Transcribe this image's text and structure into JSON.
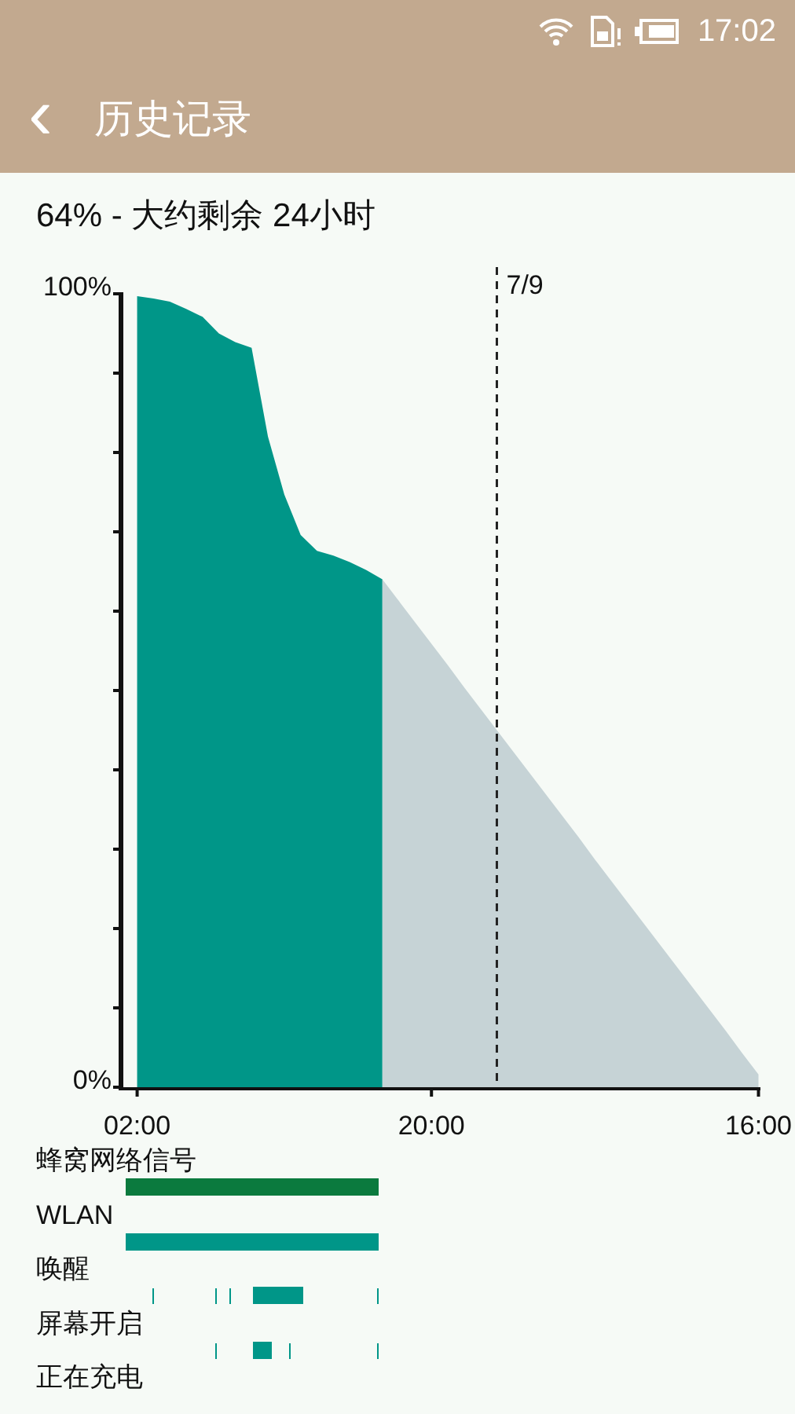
{
  "status_bar": {
    "time": "17:02"
  },
  "header": {
    "back": "‹",
    "title": "历史记录"
  },
  "summary": "64% - 大约剩余 24小时",
  "chart_data": {
    "type": "area",
    "categories": [
      "02:00",
      null,
      null,
      null,
      null,
      null,
      null,
      null,
      null,
      null,
      null,
      null,
      null,
      null,
      null,
      null,
      null,
      null,
      "20:00",
      null,
      null,
      null,
      null,
      null,
      null,
      null,
      null,
      null,
      null,
      null,
      null,
      null,
      null,
      null,
      null,
      null,
      null,
      null,
      "16:00"
    ],
    "yticks": [
      {
        "value": 0,
        "label": "0%"
      },
      {
        "value": 100,
        "label": "100%"
      }
    ],
    "ylim": [
      0,
      100
    ],
    "series": [
      {
        "color": "#009688",
        "values": [
          99.7,
          99.4,
          99,
          98.1,
          97.1,
          95,
          93.9,
          93.2,
          82,
          74.7,
          69.6,
          67.6,
          67,
          66.2,
          65.2,
          64,
          null,
          null,
          null,
          null,
          null,
          null,
          null,
          null,
          null,
          null,
          null,
          null,
          null,
          null,
          null,
          null,
          null,
          null,
          null,
          null,
          null,
          null,
          null
        ]
      },
      {
        "color": "#c6d3d6",
        "values": [
          null,
          null,
          null,
          null,
          null,
          null,
          null,
          null,
          null,
          null,
          null,
          null,
          null,
          null,
          null,
          64,
          61.3,
          58.6,
          55.9,
          53.2,
          50.4,
          47.7,
          45,
          42.3,
          39.6,
          36.9,
          34.2,
          31.5,
          28.7,
          26,
          23.3,
          20.6,
          17.9,
          15.2,
          12.5,
          9.8,
          7.1,
          4.3,
          1.6
        ]
      }
    ],
    "annotations": [
      "7/9"
    ]
  },
  "tracks": [
    {
      "label": "蜂窝网络信号",
      "color": "#0b7a3e"
    },
    {
      "label": "WLAN",
      "color": "#009688"
    },
    {
      "label": "唤醒",
      "color": "#009688"
    },
    {
      "label": "屏幕开启",
      "color": "#009688"
    },
    {
      "label": "正在充电"
    }
  ]
}
